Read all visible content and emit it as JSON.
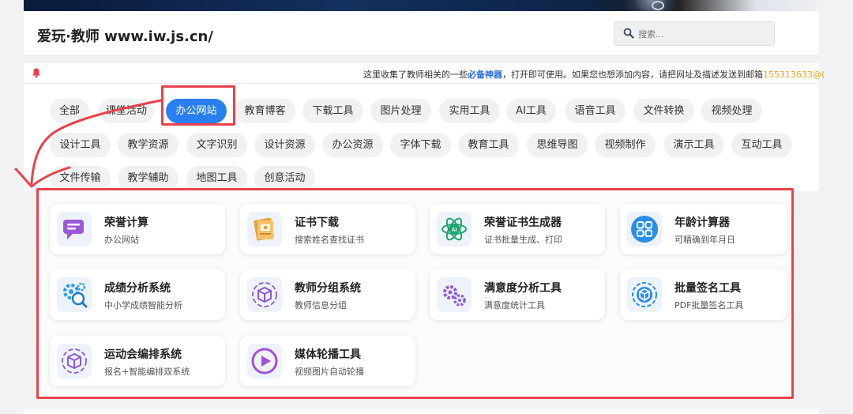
{
  "header": {
    "site_title": "爱玩·教师 www.iw.js.cn/"
  },
  "search": {
    "placeholder": "搜索..."
  },
  "notice": {
    "text_before": "这里收集了教师相关的一些",
    "text_emphasis": "必备神器",
    "text_after": "，打开即可使用。如果您也想添加内容，请把网址及描述发送到邮箱",
    "email": "155313633@("
  },
  "categories": [
    {
      "label": "全部"
    },
    {
      "label": "课堂活动"
    },
    {
      "label": "办公网站",
      "active": true
    },
    {
      "label": "教育博客"
    },
    {
      "label": "下载工具"
    },
    {
      "label": "图片处理"
    },
    {
      "label": "实用工具"
    },
    {
      "label": "AI工具"
    },
    {
      "label": "语音工具"
    },
    {
      "label": "文件转换"
    },
    {
      "label": "视频处理"
    },
    {
      "label": "设计工具"
    },
    {
      "label": "教学资源"
    },
    {
      "label": "文字识别"
    },
    {
      "label": "设计资源"
    },
    {
      "label": "办公资源"
    },
    {
      "label": "字体下载"
    },
    {
      "label": "教育工具"
    },
    {
      "label": "思维导图"
    },
    {
      "label": "视频制作"
    },
    {
      "label": "演示工具"
    },
    {
      "label": "互动工具"
    },
    {
      "label": "文件传输"
    },
    {
      "label": "教学辅助"
    },
    {
      "label": "地图工具"
    },
    {
      "label": "创意活动"
    }
  ],
  "tools": [
    {
      "name": "荣誉计算",
      "desc": "办公网站",
      "icon": "chat-bubble-icon",
      "color": "#9b59d6"
    },
    {
      "name": "证书下载",
      "desc": "搜索姓名查找证书",
      "icon": "certificate-icon",
      "color": "#e8a23a"
    },
    {
      "name": "荣誉证书生成器",
      "desc": "证书批量生成、打印",
      "icon": "ai-atom-icon",
      "color": "#1ea672"
    },
    {
      "name": "年龄计算器",
      "desc": "可精确到年月日",
      "icon": "grid-apps-icon",
      "color": "#2a8de8"
    },
    {
      "name": "成绩分析系统",
      "desc": "中小学成绩智能分析",
      "icon": "gear-search-icon",
      "color": "#2a9de8"
    },
    {
      "name": "教师分组系统",
      "desc": "教师信息分组",
      "icon": "cube-cycle-icon",
      "color": "#8e5ad6"
    },
    {
      "name": "满意度分析工具",
      "desc": "满意度统计工具",
      "icon": "gears-icon",
      "color": "#8e5ad6"
    },
    {
      "name": "批量签名工具",
      "desc": "PDF批量签名工具",
      "icon": "cube-badge-icon",
      "color": "#2a8de8"
    },
    {
      "name": "运动会编排系统",
      "desc": "报名+智能编排双系统",
      "icon": "cube-cycle-icon",
      "color": "#8e5ad6"
    },
    {
      "name": "媒体轮播工具",
      "desc": "视频图片自动轮播",
      "icon": "play-circle-icon",
      "color": "#a550d8"
    }
  ]
}
